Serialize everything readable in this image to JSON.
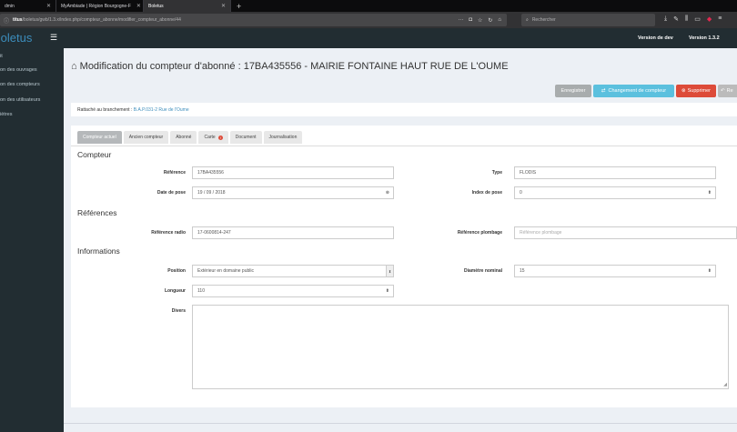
{
  "browser": {
    "tabs": [
      {
        "label": "dmin",
        "active": false
      },
      {
        "label": "MyAmbiade | Région Bourgogne-F",
        "active": false
      },
      {
        "label": "Boletus",
        "active": true
      }
    ],
    "url_host": "titus",
    "url_path": "/boletus/gwb/1.3.x/index.php/compteur_abonne/modifier_compteur_abonne/44",
    "search_placeholder": "Rechercher"
  },
  "app": {
    "brand": "Boletus",
    "version_env": "Version de dev",
    "version_num": "Version 1.3.2"
  },
  "sidebar": {
    "items": [
      {
        "label": "it"
      },
      {
        "label": "on des ouvrages"
      },
      {
        "label": "on des compteurs"
      },
      {
        "label": "on des utilisateurs"
      },
      {
        "label": "iètres"
      }
    ]
  },
  "page": {
    "title": "Modification du compteur d'abonné : 17BA435556 - MAIRIE FONTAINE HAUT RUE DE L'OUME",
    "buttons": {
      "save": "Enregistrer",
      "change": "Changement de compteur",
      "delete": "Supprimer",
      "back": "Re"
    },
    "rattache_label": "Rattaché au branchement :",
    "rattache_link": "B.A.P.031-2 Rue de l'Oume",
    "tabs": [
      "Compteur actuel",
      "Ancien compteur",
      "Abonné",
      "Carte",
      "Document",
      "Journalisation"
    ],
    "carte_badge": "!"
  },
  "form": {
    "section_compteur": "Compteur",
    "reference_label": "Référence",
    "reference_value": "17BA435556",
    "type_label": "Type",
    "type_value": "FLODIS",
    "date_pose_label": "Date de pose",
    "date_pose_value": "19 / 09 / 2018",
    "index_pose_label": "Index de pose",
    "index_pose_value": "0",
    "section_references": "Références",
    "ref_radio_label": "Référence radio",
    "ref_radio_value": "17-0600814-247",
    "ref_plombage_label": "Référence plombage",
    "ref_plombage_placeholder": "Référence plombage",
    "section_informations": "Informations",
    "position_label": "Position",
    "position_value": "Extérieur en domaine public",
    "diametre_label": "Diamètre nominal",
    "diametre_value": "15",
    "longueur_label": "Longueur",
    "longueur_value": "110",
    "divers_label": "Divers"
  },
  "icons": {
    "home": "home-icon",
    "spinner": "spin-arrows-icon",
    "clear": "clear-circle-icon",
    "stepper": "stepper-arrows-icon"
  },
  "colors": {
    "sidebar_bg": "#222d32",
    "brand": "#3c8dbc",
    "btn_info": "#5bc0de",
    "btn_danger": "#dd4b39"
  }
}
